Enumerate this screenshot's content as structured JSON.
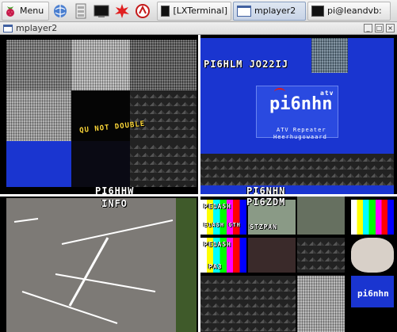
{
  "taskbar": {
    "menu_label": "Menu",
    "tasks": [
      {
        "label": "[LXTerminal]"
      },
      {
        "label": "mplayer2"
      },
      {
        "label": "pi@leandvb:"
      }
    ]
  },
  "window": {
    "title": "mplayer2",
    "controls": [
      "_",
      "□",
      "×"
    ]
  },
  "video": {
    "q1": {
      "label": "PI6HHW",
      "overlay": "QU NOT DOUBLE"
    },
    "q2": {
      "header": "PI6HLM JO22IJ",
      "logo": "pi6nhn",
      "logo_sub": "atv",
      "desc1": "ATV Repeater",
      "desc2": "Heerhugowaard",
      "label": "PI6NHN"
    },
    "q3": {
      "label": "INFO"
    },
    "q4": {
      "label": "PI6ZDM",
      "tile1": "PE1ASH",
      "tile2": "E1ASH GTH",
      "tile3": "STZPAN",
      "tile4": "PE1ASH",
      "tile5": "PA3",
      "logo": "pi6nhn"
    }
  },
  "colors": {
    "accent_blue": "#1a35d0",
    "brand_red": "#cc1122"
  }
}
